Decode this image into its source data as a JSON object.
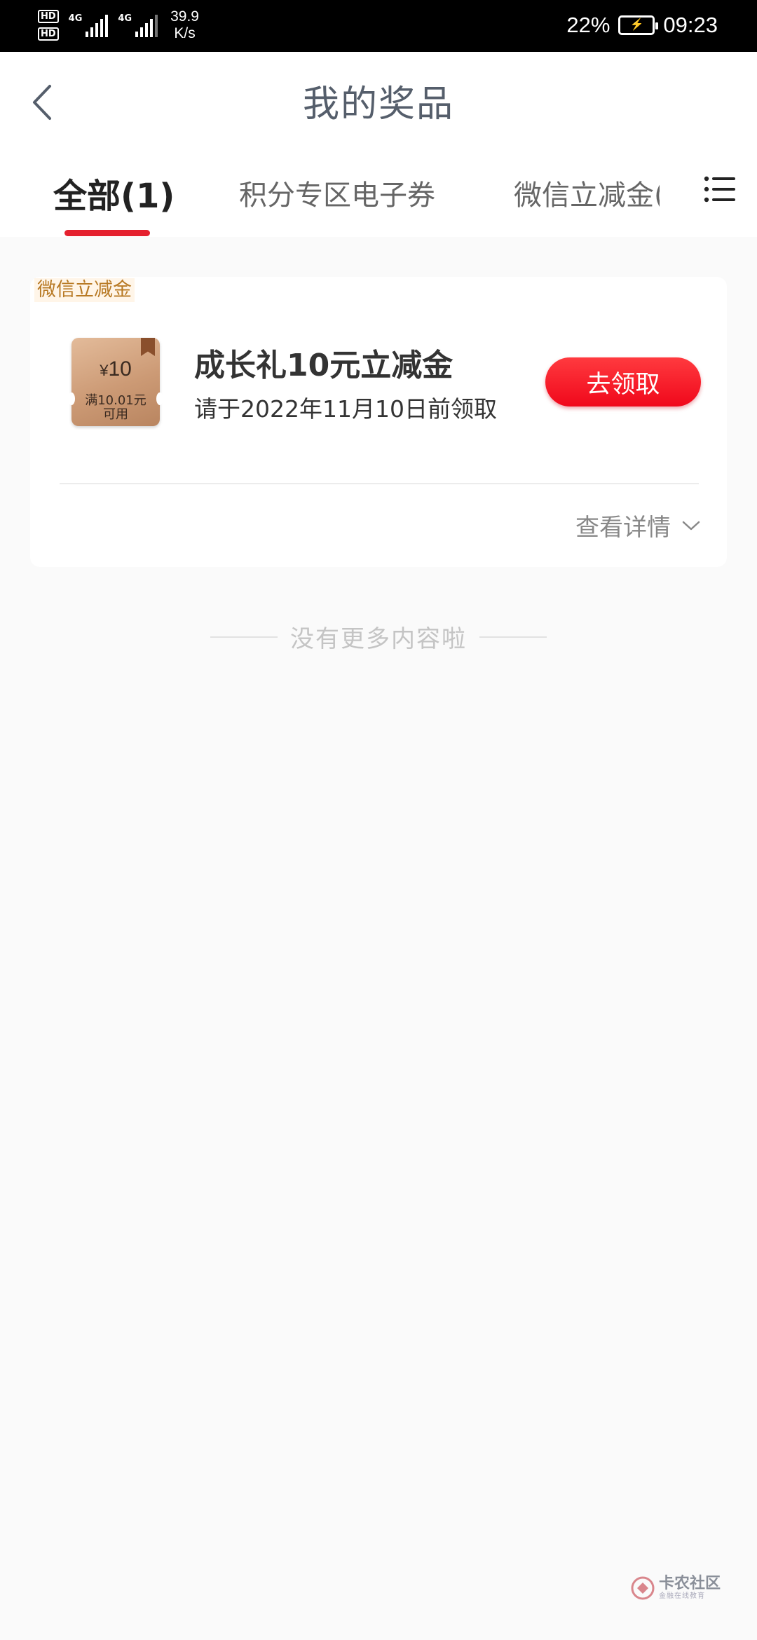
{
  "status_bar": {
    "hd1": "HD",
    "hd2": "HD",
    "net1": "4G",
    "net2": "4G",
    "speed_value": "39.9",
    "speed_unit": "K/s",
    "battery": "22%",
    "time": "09:23"
  },
  "header": {
    "title": "我的奖品",
    "tabs": [
      {
        "label": "全部(1)",
        "active": true
      },
      {
        "label": "积分专区电子券",
        "active": false
      },
      {
        "label": "微信立减金(",
        "active": false
      }
    ]
  },
  "prize": {
    "tag": "微信立减金",
    "coupon_currency": "¥",
    "coupon_amount": "10",
    "coupon_condition_line1": "满10.01元",
    "coupon_condition_line2": "可用",
    "name": "成长礼10元立减金",
    "deadline": "请于2022年11月10日前领取",
    "claim_label": "去领取",
    "details_label": "查看详情"
  },
  "list_end_text": "没有更多内容啦",
  "watermark": {
    "main": "卡农社区",
    "sub": "金融在线教育"
  },
  "colors": {
    "accent": "#e5202e",
    "tag": "#b87a25",
    "coupon": "#cc9a75"
  }
}
